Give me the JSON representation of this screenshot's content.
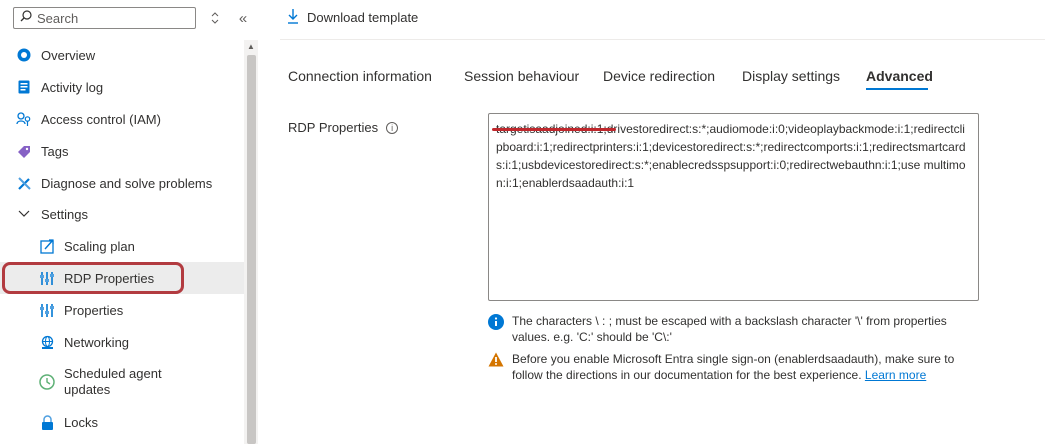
{
  "search": {
    "placeholder": "Search"
  },
  "toolbar": {
    "collapse_glyph": "«",
    "sort_glyph": "◇"
  },
  "sidebar": {
    "items": [
      {
        "label": "Overview",
        "icon": "overview-icon"
      },
      {
        "label": "Activity log",
        "icon": "activity-log-icon"
      },
      {
        "label": "Access control (IAM)",
        "icon": "access-control-icon"
      },
      {
        "label": "Tags",
        "icon": "tag-icon"
      },
      {
        "label": "Diagnose and solve problems",
        "icon": "wrench-icon"
      },
      {
        "label": "Settings",
        "icon": "chevron-down-icon"
      },
      {
        "label": "Scaling plan",
        "icon": "scaling-plan-icon"
      },
      {
        "label": "RDP Properties",
        "icon": "rdp-properties-icon",
        "selected": true
      },
      {
        "label": "Properties",
        "icon": "properties-icon"
      },
      {
        "label": "Networking",
        "icon": "networking-icon"
      },
      {
        "label": "Scheduled agent updates",
        "icon": "clock-icon"
      },
      {
        "label": "Locks",
        "icon": "lock-icon"
      }
    ]
  },
  "main": {
    "download_label": "Download template",
    "tabs": [
      {
        "label": "Connection information"
      },
      {
        "label": "Session behaviour"
      },
      {
        "label": "Device redirection"
      },
      {
        "label": "Display settings"
      },
      {
        "label": "Advanced",
        "active": true
      }
    ],
    "rdp_label": "RDP Properties",
    "info_glyph": "i",
    "rdp_value": "targetisaadjoined:i:1;drivestoredirect:s:*;audiomode:i:0;videoplaybackmode:i:1;redirectclipboard:i:1;redirectprinters:i:1;devicestoredirect:s:*;redirectcomports:i:1;redirectsmartcards:i:1;usbdevicestoredirect:s:*;enablecredsspsupport:i:0;redirectwebauthn:i:1;use multimon:i:1;enablerdsaadauth:i:1",
    "note_escape": "The characters \\ : ; must be escaped with a backslash character '\\' from properties values. e.g. 'C:' should be 'C\\:'",
    "note_warning": "Before you enable Microsoft Entra single sign-on (enablerdsaadauth), make sure to follow the directions in our documentation for the best experience.",
    "learn_more": "Learn more"
  },
  "colors": {
    "accent": "#0078d4",
    "highlight_red": "#b23b40",
    "warning": "#d47500"
  }
}
